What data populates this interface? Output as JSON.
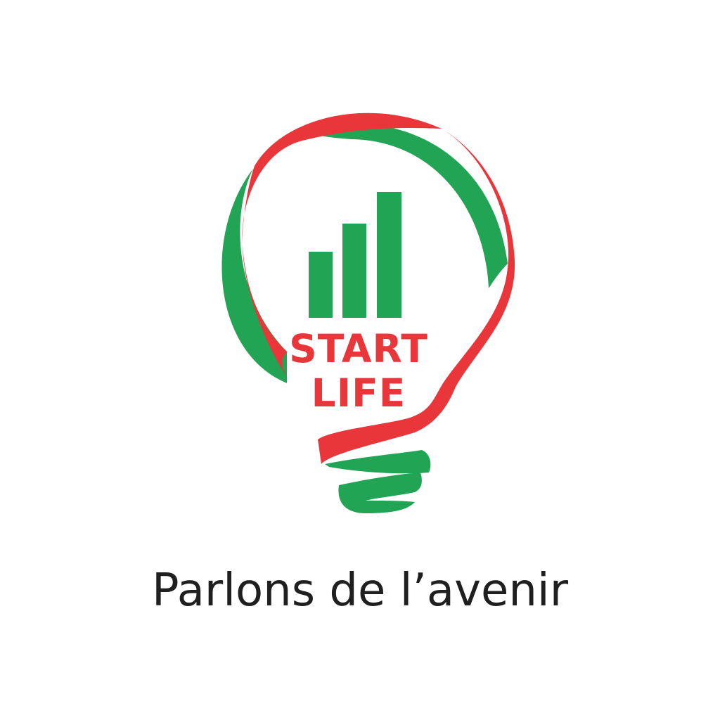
{
  "logo": {
    "line1": "START",
    "line2": "LIFE",
    "icons": [
      "lightbulb-icon",
      "bar-chart-icon"
    ],
    "colors": {
      "green": "#22a455",
      "red": "#e8363b",
      "text": "#1f1f1f",
      "background": "#ffffff"
    }
  },
  "tagline": "Parlons de l’avenir"
}
